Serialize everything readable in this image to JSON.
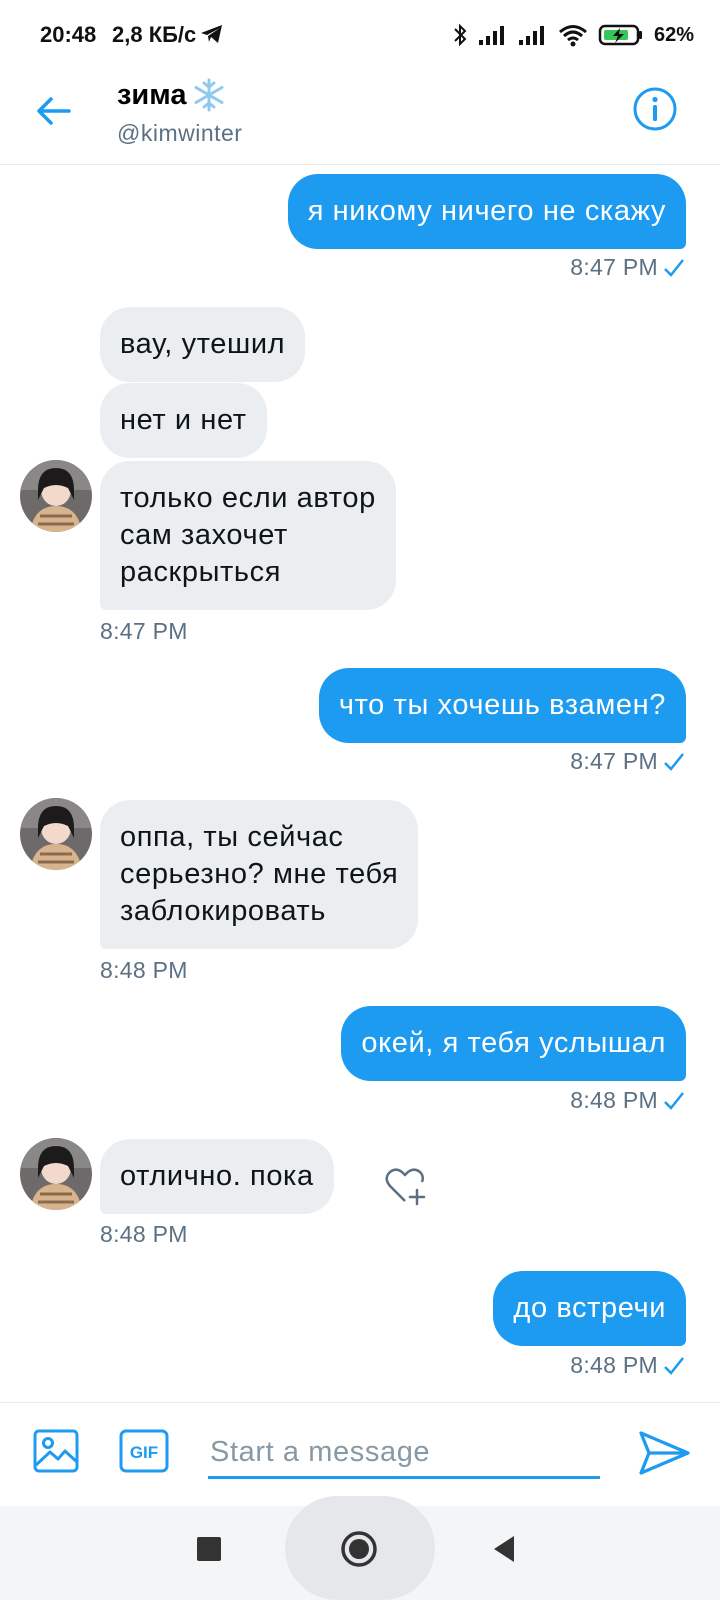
{
  "status_bar": {
    "time": "20:48",
    "speed": "2,8 КБ/с",
    "battery": "62%"
  },
  "header": {
    "name": "зима",
    "handle": "@kimwinter"
  },
  "messages": [
    {
      "dir": "out",
      "text": "я никому ничего не скажу",
      "time": "8:47 PM"
    },
    {
      "dir": "in",
      "text": "вау, утешил"
    },
    {
      "dir": "in",
      "text": "нет и нет"
    },
    {
      "dir": "in",
      "lines": [
        "только если автор",
        "сам захочет",
        "раскрыться"
      ],
      "time": "8:47 PM"
    },
    {
      "dir": "out",
      "text": "что ты хочешь взамен?",
      "time": "8:47 PM"
    },
    {
      "dir": "in",
      "lines": [
        "оппа, ты сейчас",
        "серьезно? мне тебя",
        "заблокировать"
      ],
      "time": "8:48 PM"
    },
    {
      "dir": "out",
      "text": "окей, я тебя услышал",
      "time": "8:48 PM"
    },
    {
      "dir": "in",
      "text": "отлично. пока",
      "time": "8:48 PM"
    },
    {
      "dir": "out",
      "text": "до встречи",
      "time": "8:48 PM"
    }
  ],
  "composer": {
    "placeholder": "Start a message",
    "gif_label": "GIF"
  },
  "colors": {
    "accent": "#1d9bf0",
    "incoming_bubble": "#ebeef0",
    "muted_text": "#5b7083"
  }
}
